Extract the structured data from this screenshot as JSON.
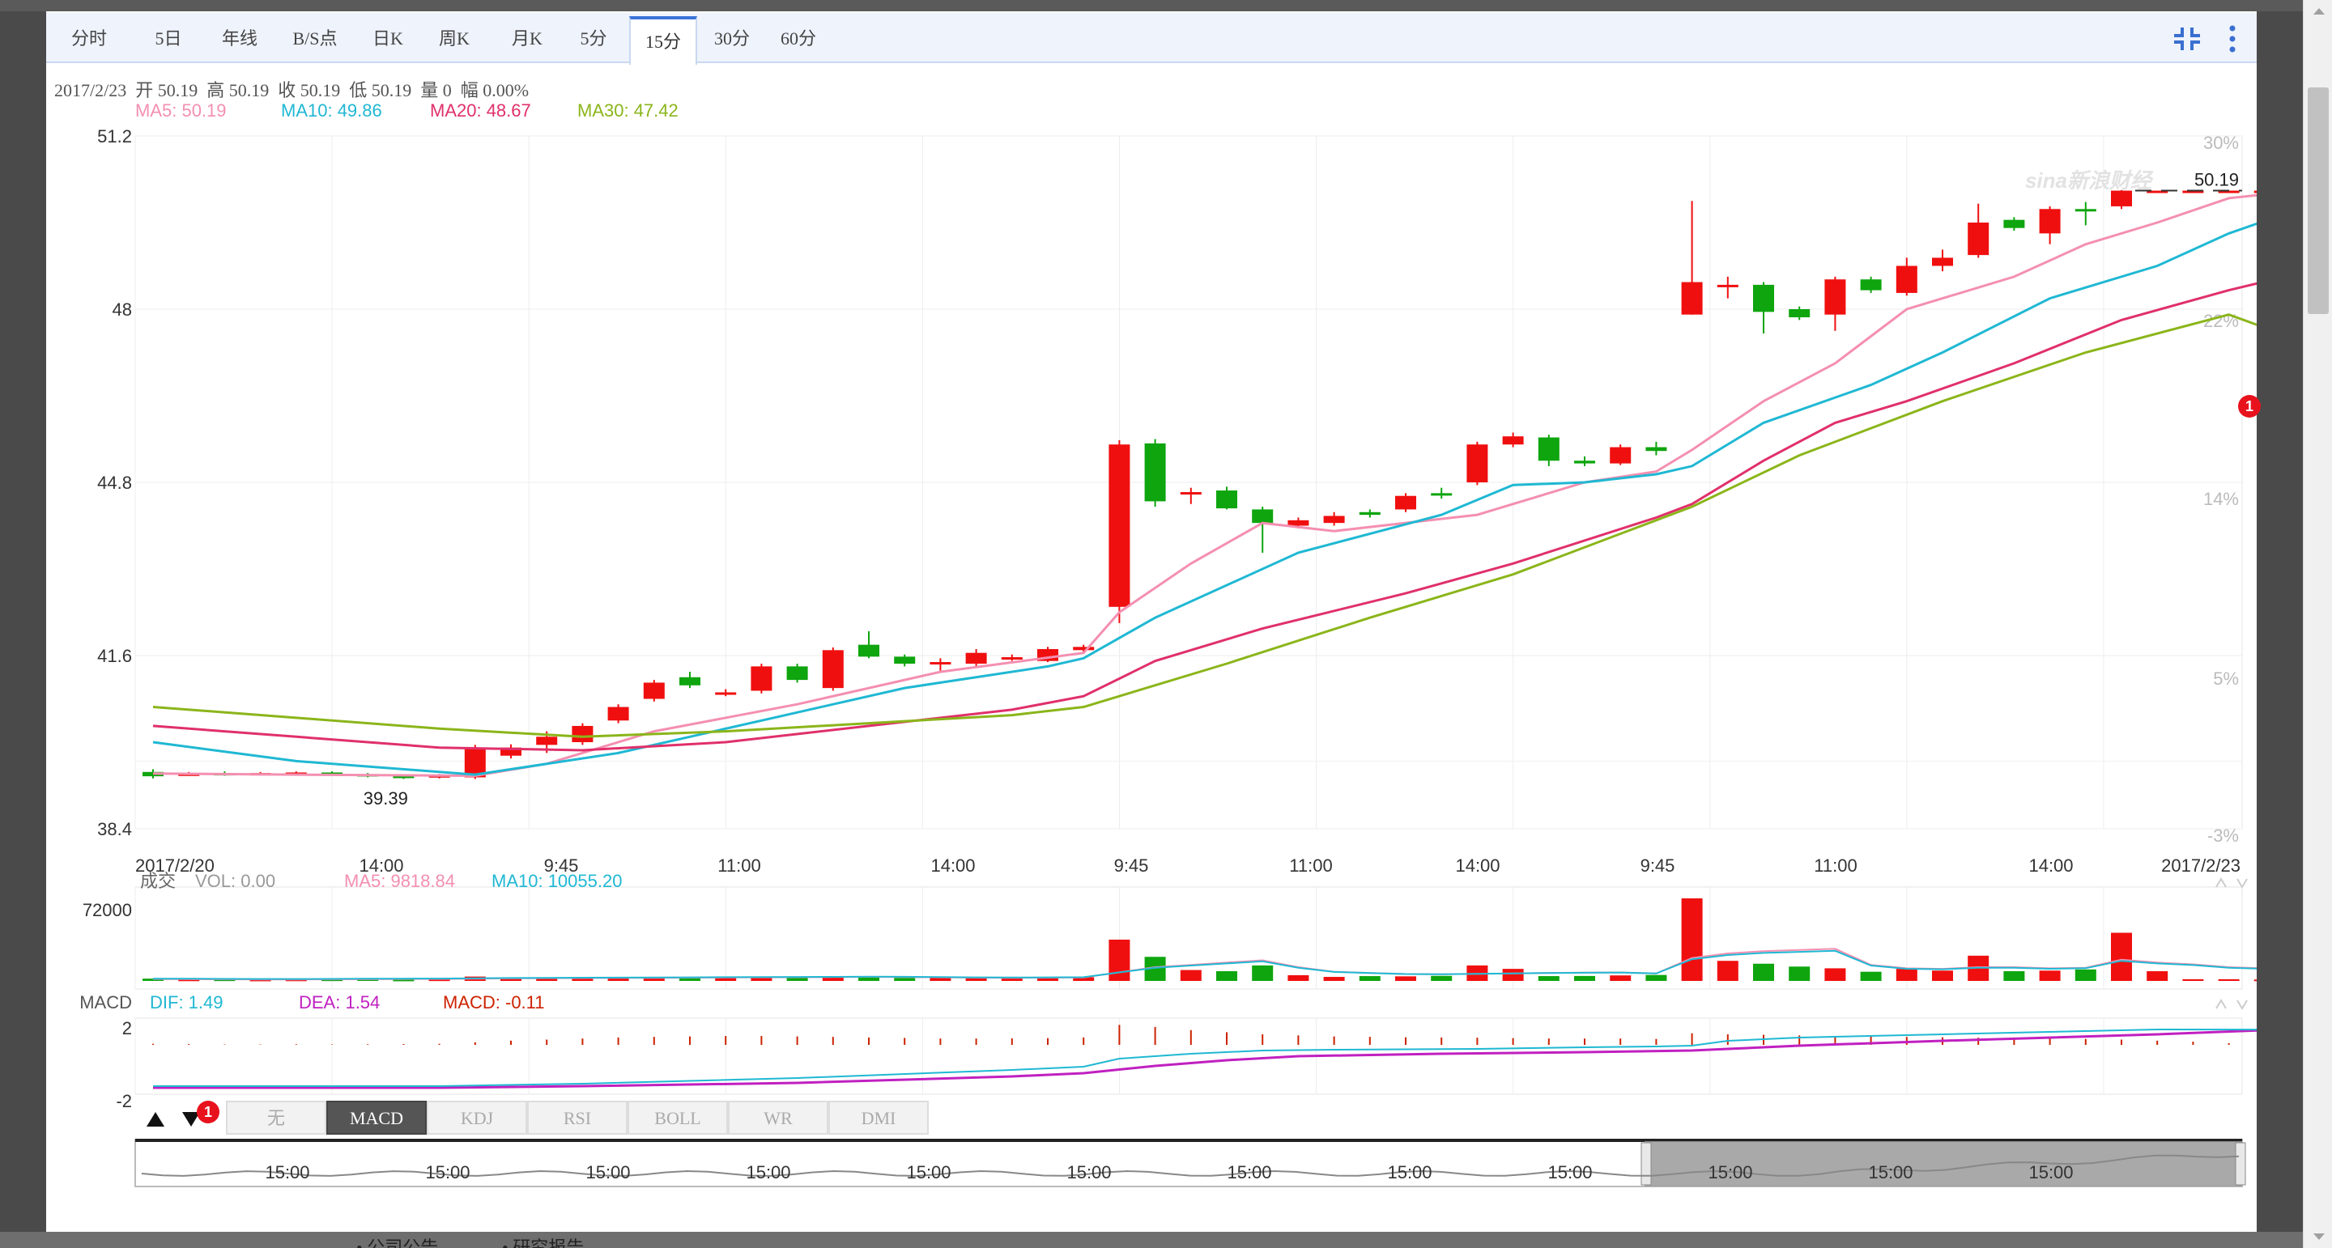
{
  "tabs": [
    {
      "label": "分时",
      "active": false
    },
    {
      "label": "5日",
      "active": false
    },
    {
      "label": "年线",
      "active": false
    },
    {
      "label": "B/S点",
      "active": false
    },
    {
      "label": "日K",
      "active": false
    },
    {
      "label": "周K",
      "active": false
    },
    {
      "label": "月K",
      "active": false
    },
    {
      "label": "5分",
      "active": false
    },
    {
      "label": "15分",
      "active": true
    },
    {
      "label": "30分",
      "active": false
    },
    {
      "label": "60分",
      "active": false
    }
  ],
  "toolbar_icons": {
    "collapse": "collapse-icon",
    "more": "more-vertical-icon"
  },
  "ohlc_line": "2017/2/23  开 50.19  高 50.19  收 50.19  低 50.19  量 0  幅 0.00%",
  "ma_legend": [
    {
      "label": "MA5: 50.19",
      "color": "#f48fb1"
    },
    {
      "label": "MA10: 49.86",
      "color": "#1fb8d3"
    },
    {
      "label": "MA20: 48.67",
      "color": "#e0306a"
    },
    {
      "label": "MA30: 47.42",
      "color": "#8bb51a"
    }
  ],
  "watermark": "sina新浪财经",
  "badge_count": "1",
  "colors": {
    "up": "#f00f0f",
    "down": "#0ea50e",
    "ma5": "#f48fb1",
    "ma10": "#1fb8d3",
    "ma20": "#e0306a",
    "ma30": "#8bb51a",
    "dif": "#1fb8d3",
    "dea": "#c020c0",
    "macd": "#cc2200"
  },
  "chart_data": {
    "type": "candlestick",
    "price_axis": {
      "ticks": [
        "51.2",
        "48",
        "44.8",
        "41.6",
        "38.4"
      ],
      "values": [
        51.2,
        48,
        44.8,
        41.6,
        38.4
      ]
    },
    "pct_axis": {
      "ticks": [
        "30%",
        "22%",
        "14%",
        "5%",
        "-3%"
      ]
    },
    "time_labels": [
      "2017/2/20",
      "14:00",
      "9:45",
      "11:00",
      "14:00",
      "9:45",
      "11:00",
      "14:00",
      "9:45",
      "11:00",
      "14:00",
      "2017/2/23"
    ],
    "last_price_label": "50.19",
    "min_price_label": "39.39",
    "candles": [
      [
        39.45,
        39.37,
        39.5,
        39.33
      ],
      [
        39.4,
        39.42,
        39.45,
        39.38
      ],
      [
        39.43,
        39.41,
        39.46,
        39.38
      ],
      [
        39.42,
        39.43,
        39.45,
        39.4
      ],
      [
        39.43,
        39.44,
        39.46,
        39.41
      ],
      [
        39.44,
        39.41,
        39.46,
        39.38
      ],
      [
        39.41,
        39.38,
        39.43,
        39.35
      ],
      [
        39.38,
        39.35,
        39.4,
        39.32
      ],
      [
        39.36,
        39.39,
        39.41,
        39.33
      ],
      [
        39.35,
        39.9,
        39.95,
        39.32
      ],
      [
        39.75,
        39.9,
        39.96,
        39.7
      ],
      [
        39.95,
        40.1,
        40.2,
        39.8
      ],
      [
        40.0,
        40.3,
        40.35,
        39.95
      ],
      [
        40.4,
        40.65,
        40.7,
        40.35
      ],
      [
        40.8,
        41.1,
        41.15,
        40.75
      ],
      [
        41.2,
        41.05,
        41.3,
        41.0
      ],
      [
        40.88,
        40.92,
        40.98,
        40.85
      ],
      [
        40.95,
        41.4,
        41.45,
        40.9
      ],
      [
        41.4,
        41.15,
        41.45,
        41.1
      ],
      [
        41.0,
        41.7,
        41.75,
        40.95
      ],
      [
        41.8,
        41.58,
        42.05,
        41.55
      ],
      [
        41.58,
        41.45,
        41.62,
        41.4
      ],
      [
        41.45,
        41.48,
        41.55,
        41.32
      ],
      [
        41.45,
        41.65,
        41.72,
        41.4
      ],
      [
        41.57,
        41.57,
        41.62,
        41.5
      ],
      [
        41.5,
        41.72,
        41.76,
        41.48
      ],
      [
        41.7,
        41.76,
        41.8,
        41.65
      ],
      [
        42.5,
        45.5,
        45.58,
        42.2
      ],
      [
        45.52,
        44.45,
        45.6,
        44.35
      ],
      [
        44.6,
        44.62,
        44.7,
        44.4
      ],
      [
        44.65,
        44.32,
        44.72,
        44.3
      ],
      [
        44.3,
        44.05,
        44.35,
        43.5
      ],
      [
        44.0,
        44.1,
        44.15,
        43.95
      ],
      [
        44.05,
        44.18,
        44.25,
        44.0
      ],
      [
        44.25,
        44.2,
        44.3,
        44.15
      ],
      [
        44.3,
        44.55,
        44.6,
        44.25
      ],
      [
        44.6,
        44.58,
        44.7,
        44.5
      ],
      [
        44.8,
        45.5,
        45.55,
        44.75
      ],
      [
        45.5,
        45.65,
        45.72,
        45.45
      ],
      [
        45.63,
        45.2,
        45.68,
        45.1
      ],
      [
        45.2,
        45.15,
        45.28,
        45.1
      ],
      [
        45.15,
        45.45,
        45.5,
        45.12
      ],
      [
        45.45,
        45.38,
        45.55,
        45.3
      ],
      [
        47.9,
        48.5,
        50.0,
        47.9
      ],
      [
        48.42,
        48.45,
        48.6,
        48.2
      ],
      [
        48.45,
        47.95,
        48.5,
        47.55
      ],
      [
        48.0,
        47.85,
        48.05,
        47.8
      ],
      [
        47.9,
        48.55,
        48.6,
        47.6
      ],
      [
        48.55,
        48.35,
        48.6,
        48.3
      ],
      [
        48.3,
        48.8,
        48.95,
        48.25
      ],
      [
        48.8,
        48.95,
        49.1,
        48.7
      ],
      [
        49.0,
        49.6,
        49.95,
        48.95
      ],
      [
        49.65,
        49.5,
        49.7,
        49.45
      ],
      [
        49.4,
        49.85,
        49.9,
        49.2
      ],
      [
        49.85,
        49.82,
        49.98,
        49.55
      ],
      [
        49.9,
        50.19,
        50.2,
        49.85
      ],
      [
        50.19,
        50.19,
        50.19,
        50.19
      ],
      [
        50.19,
        50.19,
        50.19,
        50.19
      ],
      [
        50.19,
        50.19,
        50.19,
        50.19
      ],
      [
        50.19,
        50.19,
        50.19,
        50.19
      ]
    ],
    "ma_series": {
      "MA5": [
        [
          0,
          39.42
        ],
        [
          4,
          39.4
        ],
        [
          9,
          39.38
        ],
        [
          11,
          39.6
        ],
        [
          14,
          40.2
        ],
        [
          18,
          40.7
        ],
        [
          22,
          41.3
        ],
        [
          26,
          41.65
        ],
        [
          27,
          42.4
        ],
        [
          29,
          43.3
        ],
        [
          31,
          44.05
        ],
        [
          33,
          43.9
        ],
        [
          37,
          44.2
        ],
        [
          40,
          44.8
        ],
        [
          42,
          45.0
        ],
        [
          43,
          45.4
        ],
        [
          45,
          46.3
        ],
        [
          47,
          47.0
        ],
        [
          49,
          48.0
        ],
        [
          52,
          48.6
        ],
        [
          54,
          49.2
        ],
        [
          56,
          49.6
        ],
        [
          58,
          50.05
        ],
        [
          60,
          50.19
        ]
      ],
      "MA10": [
        [
          0,
          40.0
        ],
        [
          4,
          39.65
        ],
        [
          9,
          39.4
        ],
        [
          13,
          39.8
        ],
        [
          17,
          40.4
        ],
        [
          21,
          41.0
        ],
        [
          25,
          41.4
        ],
        [
          26,
          41.55
        ],
        [
          28,
          42.3
        ],
        [
          32,
          43.5
        ],
        [
          36,
          44.2
        ],
        [
          38,
          44.75
        ],
        [
          40,
          44.8
        ],
        [
          42,
          44.95
        ],
        [
          43,
          45.1
        ],
        [
          45,
          45.9
        ],
        [
          48,
          46.6
        ],
        [
          50,
          47.2
        ],
        [
          53,
          48.2
        ],
        [
          56,
          48.8
        ],
        [
          58,
          49.4
        ],
        [
          60,
          49.86
        ]
      ],
      "MA20": [
        [
          0,
          40.3
        ],
        [
          4,
          40.1
        ],
        [
          8,
          39.9
        ],
        [
          12,
          39.85
        ],
        [
          16,
          40.0
        ],
        [
          20,
          40.3
        ],
        [
          24,
          40.6
        ],
        [
          26,
          40.85
        ],
        [
          28,
          41.5
        ],
        [
          31,
          42.1
        ],
        [
          35,
          42.75
        ],
        [
          38,
          43.3
        ],
        [
          42,
          44.15
        ],
        [
          43,
          44.4
        ],
        [
          45,
          45.2
        ],
        [
          47,
          45.9
        ],
        [
          49,
          46.3
        ],
        [
          52,
          47.0
        ],
        [
          55,
          47.8
        ],
        [
          58,
          48.35
        ],
        [
          60,
          48.67
        ]
      ],
      "MA30": [
        [
          0,
          40.65
        ],
        [
          4,
          40.45
        ],
        [
          8,
          40.25
        ],
        [
          12,
          40.1
        ],
        [
          16,
          40.2
        ],
        [
          20,
          40.35
        ],
        [
          24,
          40.5
        ],
        [
          26,
          40.65
        ],
        [
          30,
          41.45
        ],
        [
          34,
          42.3
        ],
        [
          38,
          43.1
        ],
        [
          41,
          43.85
        ],
        [
          43,
          44.35
        ],
        [
          46,
          45.3
        ],
        [
          50,
          46.3
        ],
        [
          54,
          47.2
        ],
        [
          58,
          47.9
        ],
        [
          60,
          47.42
        ]
      ]
    },
    "volume": {
      "label_prefix": "成交",
      "legend": [
        {
          "label": "VOL: 0.00",
          "color": "#999999"
        },
        {
          "label": "MA5: 9818.84",
          "color": "#f48fb1"
        },
        {
          "label": "MA10: 10055.20",
          "color": "#1fb8d3"
        }
      ],
      "ytick": "72000",
      "values": [
        2000,
        1200,
        1300,
        1100,
        1200,
        1300,
        1400,
        1100,
        1300,
        3800,
        2500,
        2600,
        2400,
        2300,
        2700,
        2500,
        2600,
        2700,
        3100,
        3600,
        3900,
        2700,
        2600,
        2400,
        2600,
        2700,
        3200,
        36000,
        21000,
        9500,
        8500,
        13500,
        5000,
        3500,
        4200,
        4000,
        4400,
        13500,
        10500,
        4200,
        4300,
        4800,
        5200,
        72000,
        17500,
        15000,
        12500,
        11000,
        8000,
        10500,
        9000,
        22000,
        8500,
        9000,
        10000,
        42000,
        8500,
        1500,
        1500,
        1200,
        1000
      ],
      "ma5": [
        1600,
        1500,
        1400,
        1300,
        1300,
        1400,
        1500,
        1600,
        1700,
        2000,
        2200,
        2400,
        2500,
        2600,
        2700,
        2800,
        3000,
        3100,
        3200,
        3300,
        3500,
        3400,
        3100,
        2800,
        2700,
        2800,
        3000,
        7500,
        12000,
        14000,
        16000,
        18000,
        12000,
        8000,
        7000,
        6000,
        5800,
        6200,
        6500,
        7000,
        7200,
        7400,
        6500,
        20000,
        24000,
        26000,
        27000,
        28000,
        14000,
        11000,
        10500,
        12000,
        12000,
        11000,
        11500,
        18500,
        16000,
        14500,
        12000,
        11000,
        9818
      ]
    },
    "macd": {
      "label": "MACD",
      "legend": [
        {
          "label": "DIF: 1.49",
          "color": "#1fb8d3"
        },
        {
          "label": "DEA: 1.54",
          "color": "#c020c0"
        },
        {
          "label": "MACD: -0.11",
          "color": "#cc2200"
        }
      ],
      "yticks": [
        "2",
        "-2"
      ],
      "dif": [
        [
          0,
          -2.0
        ],
        [
          8,
          -2.0
        ],
        [
          12,
          -1.85
        ],
        [
          18,
          -1.5
        ],
        [
          24,
          -1.0
        ],
        [
          26,
          -0.8
        ],
        [
          27,
          -0.3
        ],
        [
          29,
          0.0
        ],
        [
          31,
          0.2
        ],
        [
          33,
          0.25
        ],
        [
          37,
          0.3
        ],
        [
          40,
          0.4
        ],
        [
          42,
          0.45
        ],
        [
          43,
          0.5
        ],
        [
          44,
          0.8
        ],
        [
          46,
          1.0
        ],
        [
          50,
          1.2
        ],
        [
          56,
          1.5
        ],
        [
          60,
          1.49
        ]
      ],
      "dea": [
        [
          0,
          -2.1
        ],
        [
          8,
          -2.1
        ],
        [
          12,
          -2.0
        ],
        [
          18,
          -1.8
        ],
        [
          24,
          -1.4
        ],
        [
          26,
          -1.2
        ],
        [
          28,
          -0.75
        ],
        [
          30,
          -0.4
        ],
        [
          32,
          -0.15
        ],
        [
          36,
          0.0
        ],
        [
          40,
          0.1
        ],
        [
          43,
          0.2
        ],
        [
          44,
          0.3
        ],
        [
          46,
          0.5
        ],
        [
          50,
          0.8
        ],
        [
          56,
          1.2
        ],
        [
          60,
          1.54
        ]
      ],
      "hist": [
        0.05,
        0.04,
        0.02,
        0.02,
        0.03,
        0.02,
        0.03,
        0.04,
        0.05,
        0.12,
        0.2,
        0.25,
        0.3,
        0.35,
        0.38,
        0.4,
        0.42,
        0.42,
        0.4,
        0.38,
        0.35,
        0.33,
        0.3,
        0.3,
        0.31,
        0.32,
        0.35,
        0.95,
        0.85,
        0.7,
        0.6,
        0.5,
        0.45,
        0.4,
        0.38,
        0.36,
        0.35,
        0.34,
        0.32,
        0.3,
        0.3,
        0.3,
        0.28,
        0.55,
        0.5,
        0.48,
        0.45,
        0.42,
        0.4,
        0.38,
        0.36,
        0.34,
        0.32,
        0.3,
        0.28,
        0.25,
        0.2,
        0.15,
        0.08,
        0.02,
        -0.11
      ]
    },
    "indicator_tabs": [
      {
        "label": "无",
        "active": false
      },
      {
        "label": "MACD",
        "active": true
      },
      {
        "label": "KDJ",
        "active": false
      },
      {
        "label": "RSI",
        "active": false
      },
      {
        "label": "BOLL",
        "active": false
      },
      {
        "label": "WR",
        "active": false
      },
      {
        "label": "DMI",
        "active": false
      }
    ],
    "navigator": {
      "labels": [
        "15:00",
        "15:00",
        "15:00",
        "15:00",
        "15:00",
        "15:00",
        "15:00",
        "15:00",
        "15:00",
        "15:00",
        "15:00",
        "15:00"
      ]
    }
  }
}
